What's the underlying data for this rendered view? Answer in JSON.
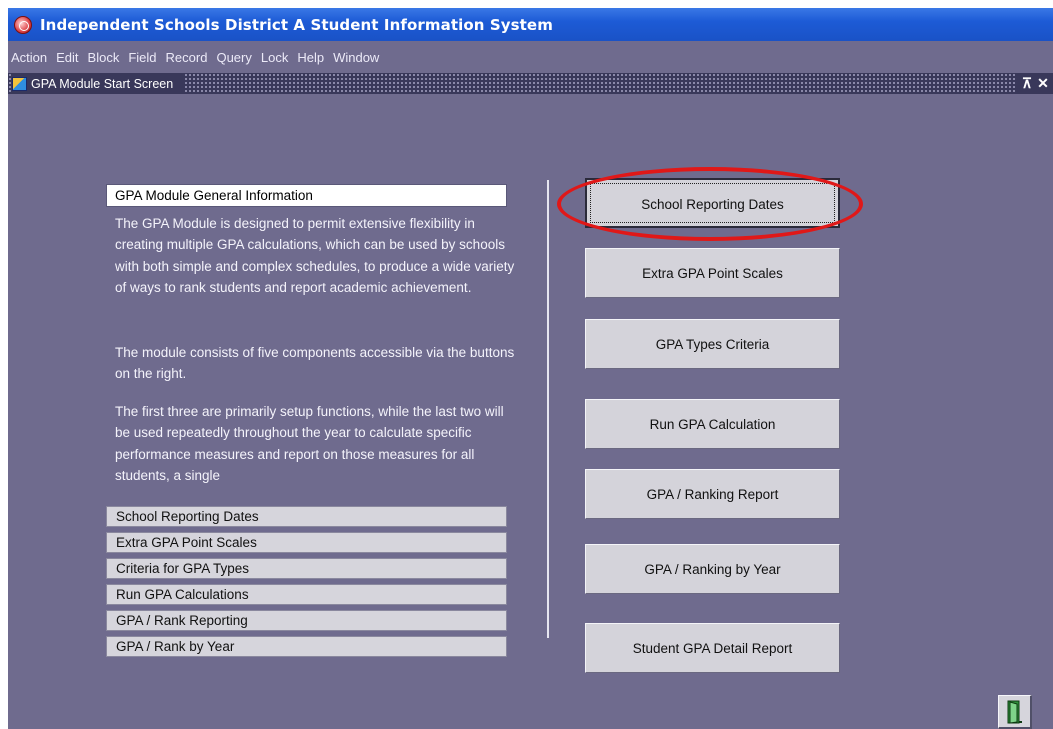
{
  "window": {
    "title": "Independent Schools District A Student Information System",
    "menu": [
      "Action",
      "Edit",
      "Block",
      "Field",
      "Record",
      "Query",
      "Lock",
      "Help",
      "Window"
    ]
  },
  "form": {
    "title": "GPA Module Start Screen",
    "controls": {
      "restore": "⊼",
      "close": "✕"
    }
  },
  "info": {
    "heading": "GPA Module General Information",
    "paragraphs": [
      "The GPA Module is designed to permit extensive flexibility in creating multiple GPA calculations, which can be used by schools with both simple and complex schedules, to produce a wide variety of ways to rank students and report academic achievement.",
      "The module consists of five components accessible via the buttons on the right.",
      "The first three are primarily setup functions, while the last two will be used repeatedly throughout the year to calculate specific performance measures and report on those measures for all students, a single"
    ],
    "list": [
      "School Reporting Dates",
      "Extra GPA Point Scales",
      "Criteria for GPA Types",
      "Run GPA Calculations",
      "GPA / Rank Reporting",
      "GPA / Rank by Year"
    ]
  },
  "buttons": [
    "School Reporting Dates",
    "Extra GPA Point Scales",
    "GPA Types Criteria",
    "Run GPA Calculation",
    "GPA / Ranking Report",
    "GPA / Ranking by Year",
    "Student GPA Detail Report"
  ],
  "focused_button": "School Reporting Dates",
  "highlight_color": "#e01818",
  "icons": {
    "app": "app-logo-icon",
    "form": "form-icon",
    "exit": "exit-door-icon"
  }
}
